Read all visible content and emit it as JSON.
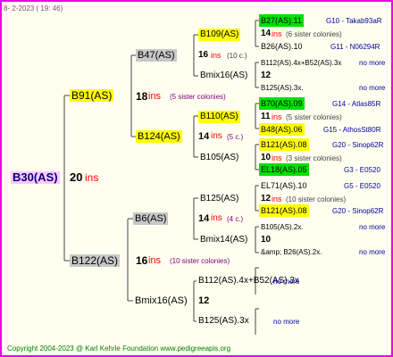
{
  "header": {
    "date": "8-  2-2023  ( 19:  46)"
  },
  "footer": {
    "copyright": "Copyright 2004-2023 @ Karl Kehrle Foundation    www.pedigreeapis.org"
  },
  "root": {
    "name": "B30(AS)",
    "count": "20",
    "ins": "ins"
  },
  "gen1": [
    {
      "name": "B91(AS)",
      "count": "18",
      "ins": "ins",
      "sister": "(5 sister colonies)"
    },
    {
      "name": "B122(AS)",
      "count": "16",
      "ins": "ins",
      "sister": "(10 sister colonies)"
    }
  ],
  "gen2": [
    {
      "name": "B47(AS)"
    },
    {
      "name": "B124(AS)",
      "count": "14",
      "ins": "ins",
      "sister": "(5 c.)"
    },
    {
      "name": "B6(AS)",
      "count": "14",
      "ins": "ins",
      "sister": "(4 c.)"
    },
    {
      "name": "Bmix16(AS)",
      "count": "12"
    }
  ],
  "gen3": [
    {
      "name": "B109(AS)",
      "count": "16",
      "ins": "ins",
      "sister": "(10 c.)"
    },
    {
      "name": "Bmix16(AS)"
    },
    {
      "name": "B110(AS)",
      "count": "11",
      "ins": "ins",
      "sister": "(5 c.)"
    },
    {
      "name": "B105(AS)"
    },
    {
      "name": "B125(AS)"
    },
    {
      "name": "Bmix14(AS)"
    },
    {
      "name": "B112(AS).4x+B52(AS).3x"
    },
    {
      "name": "B125(AS).3x"
    }
  ],
  "gen4": [
    {
      "name": "B27(AS).11",
      "ref": "G10 - Takab93aR"
    },
    {
      "name": "14",
      "ins": "ins",
      "sister": "(6 sister colonies)"
    },
    {
      "name": "B26(AS).10",
      "ref": "G11 - N06294R"
    },
    {
      "name": "B112(AS).4x+B52(AS).3x",
      "ref": "no more"
    },
    {
      "name": "12"
    },
    {
      "name": "B125(AS).3x.",
      "ref": "no more"
    },
    {
      "name": "B70(AS).09",
      "ref": "G14 - Atlas85R"
    },
    {
      "name": "11",
      "ins": "ins",
      "sister": "(5 sister colonies)"
    },
    {
      "name": "B48(AS).06",
      "ref": "G15 - AthosSt80R"
    },
    {
      "name": "B121(AS).08",
      "ref": "G20 - Sinop62R"
    },
    {
      "name": "10",
      "ins": "ins",
      "sister": "(3 sister colonies)"
    },
    {
      "name": "EL18(AS).05",
      "ref": "G3 - E0520"
    },
    {
      "name": "EL71(AS).10",
      "ref": "G5 - E0520"
    },
    {
      "name": "12",
      "ins": "ins",
      "sister": "(10 sister colonies)"
    },
    {
      "name": "B121(AS).08",
      "ref": "G20 - Sinop62R"
    },
    {
      "name": "B105(AS).2x.",
      "ref": "no more"
    },
    {
      "name": "10"
    },
    {
      "name": "&amp; B26(AS).2x.",
      "ref": "no more"
    },
    {
      "name": "B52",
      "ref": "no more"
    },
    {
      "name": "x",
      "ref": "no more"
    }
  ]
}
